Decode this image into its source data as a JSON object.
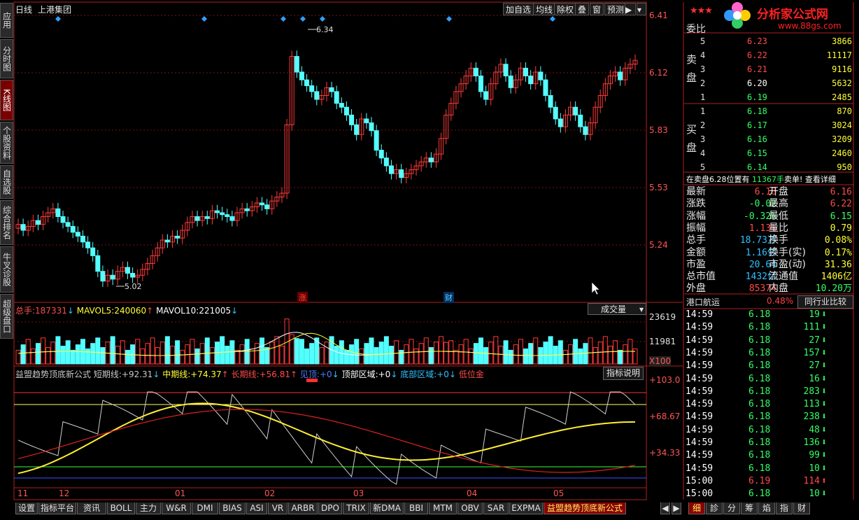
{
  "header": {
    "period": "日线",
    "stock": "上港集团"
  },
  "toolbar": [
    "加自选",
    "均线",
    "除权",
    "叠",
    "窗",
    "预测"
  ],
  "left_tabs": [
    {
      "label": "应用",
      "active": false
    },
    {
      "label": "分时图",
      "active": false
    },
    {
      "label": "K线图",
      "active": true
    },
    {
      "label": "个股资料",
      "active": false
    },
    {
      "label": "自选股",
      "active": false
    },
    {
      "label": "综合排名",
      "active": false
    },
    {
      "label": "牛叉诊股",
      "active": false
    },
    {
      "label": "超级盘口",
      "active": false
    }
  ],
  "price_axis": [
    "6.41",
    "6.12",
    "5.83",
    "5.53",
    "5.24"
  ],
  "high_label": "6.34",
  "low_label": "5.02",
  "markers": {
    "zhang": "涨",
    "cai": "财"
  },
  "volume": {
    "total_label": "总手:",
    "total": "187331",
    "ma5_label": "MAVOL5:",
    "ma5": "240060",
    "ma10_label": "MAVOL10:",
    "ma10": "221005",
    "selector": "成交量",
    "axis": [
      "23619",
      "11981"
    ],
    "unit": "X100"
  },
  "indicator": {
    "name": "益盟趋势顶底新公式",
    "short_label": "短期线:",
    "short": "+92.31",
    "mid_label": "中期线:",
    "mid": "+74.37",
    "long_label": "长期线:",
    "long": "+56.81",
    "top_label": "见顶:",
    "top": "+0",
    "topzone_label": "顶部区域:",
    "topzone": "+0",
    "bottomzone_label": "底部区域:",
    "bottomzone": "+0",
    "low_label": "低位金",
    "help": "指标说明",
    "axis": [
      "+103.0",
      "+68.67",
      "+34.33"
    ]
  },
  "months": [
    "11",
    "12",
    "01",
    "02",
    "03",
    "04",
    "05"
  ],
  "bottom_tabs": [
    "设置",
    "指标平台",
    "资讯",
    "BOLL",
    "主力",
    "W&R",
    "DMI",
    "BIAS",
    "ASI",
    "VR",
    "ARBR",
    "DPO",
    "TRIX",
    "新DMA",
    "BBI",
    "MTM",
    "OBV",
    "SAR",
    "EXPMA",
    "益盟趋势顶底新公式"
  ],
  "right_tabs": [
    "细",
    "診",
    "分",
    "筹",
    "焰",
    "指",
    "财"
  ],
  "logo": {
    "name": "分析家公式网",
    "url": "www.88gs.com"
  },
  "orderbook": {
    "weibi": "委比",
    "sell_label": "卖盘",
    "buy_label": "买盘",
    "sell": [
      {
        "lvl": "5",
        "price": "6.23",
        "vol": "3866"
      },
      {
        "lvl": "4",
        "price": "6.22",
        "vol": "11117"
      },
      {
        "lvl": "3",
        "price": "6.21",
        "vol": "9116"
      },
      {
        "lvl": "2",
        "price": "6.20",
        "vol": "5632"
      },
      {
        "lvl": "1",
        "price": "6.19",
        "vol": "2485"
      }
    ],
    "buy": [
      {
        "lvl": "1",
        "price": "6.18",
        "vol": "870"
      },
      {
        "lvl": "2",
        "price": "6.17",
        "vol": "3024"
      },
      {
        "lvl": "3",
        "price": "6.16",
        "vol": "3209"
      },
      {
        "lvl": "4",
        "price": "6.15",
        "vol": "2460"
      },
      {
        "lvl": "5",
        "price": "6.14",
        "vol": "950"
      }
    ],
    "notice1": "在卖盘6.28位置有",
    "notice2": "11367手",
    "notice3": "卖单!",
    "notice4": "查看详细"
  },
  "stats": [
    [
      "最新",
      "6.18",
      "开盘",
      "6.16"
    ],
    [
      "涨跌",
      "-0.02",
      "最高",
      "6.22"
    ],
    [
      "涨幅",
      "-0.32%",
      "最低",
      "6.15"
    ],
    [
      "振幅",
      "1.13%",
      "量比",
      "0.79"
    ],
    [
      "总手",
      "18.73万",
      "换手",
      "0.08%"
    ],
    [
      "金额",
      "1.16亿",
      "换手(实)",
      "0.17%"
    ],
    [
      "市盈",
      "20.64",
      "市盈(动)",
      "31.36"
    ],
    [
      "总市值",
      "1432亿",
      "流通值",
      "1406亿"
    ],
    [
      "外盘",
      "85374",
      "内盘",
      "10.20万"
    ]
  ],
  "sector": {
    "name": "港口航运",
    "pct": "0.48%",
    "compare": "同行业比较"
  },
  "ticks": [
    [
      "14:59",
      "6.18",
      "19",
      "d"
    ],
    [
      "14:59",
      "6.18",
      "111",
      "d"
    ],
    [
      "14:59",
      "6.18",
      "27",
      "d"
    ],
    [
      "14:59",
      "6.18",
      "157",
      "d"
    ],
    [
      "14:59",
      "6.18",
      "27",
      "d"
    ],
    [
      "14:59",
      "6.18",
      "16",
      "d"
    ],
    [
      "14:59",
      "6.18",
      "283",
      "d"
    ],
    [
      "14:59",
      "6.18",
      "113",
      "d"
    ],
    [
      "14:59",
      "6.18",
      "238",
      "d"
    ],
    [
      "14:59",
      "6.18",
      "48",
      "d"
    ],
    [
      "14:59",
      "6.18",
      "136",
      "d"
    ],
    [
      "14:59",
      "6.18",
      "99",
      "d"
    ],
    [
      "14:59",
      "6.18",
      "10",
      "d"
    ],
    [
      "15:00",
      "6.19",
      "114",
      "u"
    ],
    [
      "15:00",
      "6.18",
      "10",
      "d"
    ]
  ]
}
